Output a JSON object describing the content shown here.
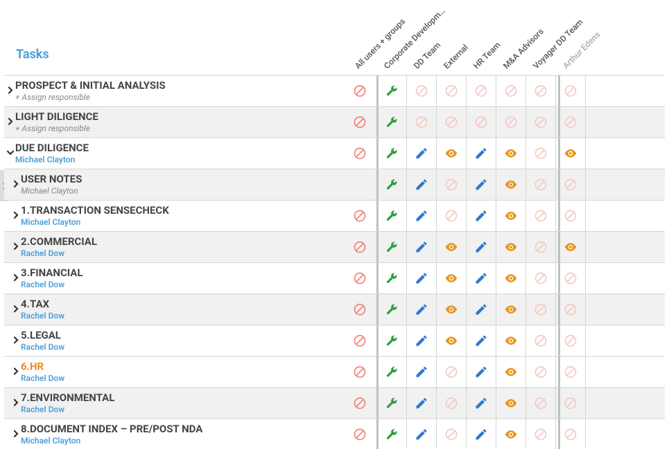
{
  "title": "Tasks",
  "columns": [
    {
      "label": "All users + groups",
      "user": false
    },
    {
      "label": "Corporate Developm…",
      "user": false
    },
    {
      "label": "DD Team",
      "user": false
    },
    {
      "label": "External",
      "user": false
    },
    {
      "label": "HR Team",
      "user": false
    },
    {
      "label": "M&A Advisors",
      "user": false
    },
    {
      "label": "Voyager DD Team",
      "user": false
    },
    {
      "label": "Arthur Edens",
      "user": true
    }
  ],
  "rows": [
    {
      "title": "PROSPECT & INITIAL ANALYSIS",
      "sub": "+ Assign responsible",
      "subLink": false,
      "level": 0,
      "expanded": false,
      "alt": false,
      "cells": [
        "none",
        "wrench",
        "faded",
        "faded",
        "faded",
        "faded",
        "faded",
        "faded"
      ]
    },
    {
      "title": "LIGHT DILIGENCE",
      "sub": "+ Assign responsible",
      "subLink": false,
      "level": 0,
      "expanded": false,
      "alt": true,
      "cells": [
        "none",
        "wrench",
        "faded",
        "faded",
        "faded",
        "faded",
        "faded",
        "faded"
      ]
    },
    {
      "title": "DUE DILIGENCE",
      "sub": "Michael Clayton",
      "subLink": true,
      "level": 0,
      "expanded": true,
      "alt": false,
      "cells": [
        "none",
        "wrench",
        "pencil",
        "eye",
        "pencil",
        "eye",
        "faded",
        "eye"
      ]
    },
    {
      "title": "USER NOTES",
      "sub": "Michael Clayton",
      "subLink": false,
      "level": 1,
      "expanded": false,
      "alt": true,
      "cells": [
        "",
        "wrench",
        "pencil",
        "faded",
        "pencil",
        "eye",
        "faded",
        "faded"
      ]
    },
    {
      "title": "1.TRANSACTION SENSECHECK",
      "sub": "Michael Clayton",
      "subLink": true,
      "level": 1,
      "expanded": false,
      "alt": false,
      "cells": [
        "none",
        "wrench",
        "pencil",
        "faded",
        "pencil",
        "eye",
        "faded",
        "faded"
      ]
    },
    {
      "title": "2.COMMERCIAL",
      "sub": "Rachel Dow",
      "subLink": true,
      "level": 1,
      "expanded": false,
      "alt": true,
      "cells": [
        "none",
        "wrench",
        "pencil",
        "eye",
        "pencil",
        "eye",
        "faded",
        "eye"
      ]
    },
    {
      "title": "3.FINANCIAL",
      "sub": "Rachel Dow",
      "subLink": true,
      "level": 1,
      "expanded": false,
      "alt": false,
      "cells": [
        "none",
        "wrench",
        "pencil",
        "eye",
        "pencil",
        "eye",
        "faded",
        "faded"
      ]
    },
    {
      "title": "4.TAX",
      "sub": "Rachel Dow",
      "subLink": true,
      "level": 1,
      "expanded": false,
      "alt": true,
      "cells": [
        "none",
        "wrench",
        "pencil",
        "eye",
        "pencil",
        "eye",
        "faded",
        "faded"
      ]
    },
    {
      "title": "5.LEGAL",
      "sub": "Rachel Dow",
      "subLink": true,
      "level": 1,
      "expanded": false,
      "alt": false,
      "cells": [
        "none",
        "wrench",
        "pencil",
        "eye",
        "pencil",
        "eye",
        "faded",
        "faded"
      ]
    },
    {
      "title": "6.HR",
      "sub": "Rachel Dow",
      "subLink": true,
      "level": 1,
      "expanded": false,
      "alt": false,
      "selected": true,
      "cells": [
        "none",
        "wrench",
        "pencil",
        "faded",
        "pencil",
        "eye",
        "faded",
        "faded"
      ]
    },
    {
      "title": "7.ENVIRONMENTAL",
      "sub": "Rachel Dow",
      "subLink": true,
      "level": 1,
      "expanded": false,
      "alt": true,
      "cells": [
        "none",
        "wrench",
        "pencil",
        "faded",
        "pencil",
        "eye",
        "faded",
        "faded"
      ]
    },
    {
      "title": "8.DOCUMENT INDEX – PRE/POST NDA",
      "sub": "Michael Clayton",
      "subLink": true,
      "level": 1,
      "expanded": false,
      "alt": false,
      "cells": [
        "none",
        "wrench",
        "pencil",
        "faded",
        "pencil",
        "eye",
        "faded",
        "faded"
      ]
    }
  ]
}
